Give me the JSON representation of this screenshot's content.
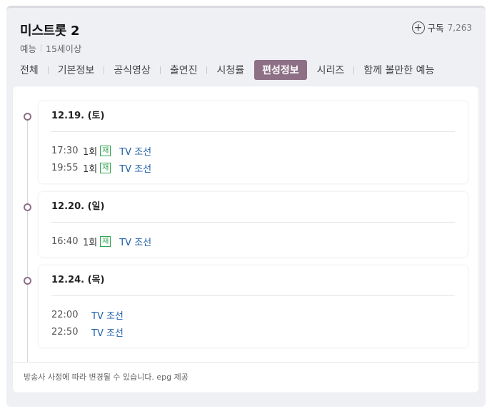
{
  "program": {
    "title": "미스트롯 2",
    "genre": "예능",
    "rating": "15세이상"
  },
  "subscribe": {
    "label": "구독",
    "count": "7,263"
  },
  "tabs": [
    {
      "label": "전체"
    },
    {
      "label": "기본정보"
    },
    {
      "label": "공식영상"
    },
    {
      "label": "출연진"
    },
    {
      "label": "시청률"
    },
    {
      "label": "편성정보",
      "active": true
    },
    {
      "label": "시리즈"
    },
    {
      "label": "함께 볼만한 예능"
    }
  ],
  "schedule": [
    {
      "date": "12.19. (토)",
      "slots": [
        {
          "time": "17:30",
          "episode": "1회",
          "badge": "재",
          "channel": "TV 조선"
        },
        {
          "time": "19:55",
          "episode": "1회",
          "badge": "재",
          "channel": "TV 조선"
        }
      ]
    },
    {
      "date": "12.20. (일)",
      "slots": [
        {
          "time": "16:40",
          "episode": "1회",
          "badge": "재",
          "channel": "TV 조선"
        }
      ]
    },
    {
      "date": "12.24. (목)",
      "slots": [
        {
          "time": "22:00",
          "channel": "TV 조선"
        },
        {
          "time": "22:50",
          "channel": "TV 조선"
        }
      ]
    }
  ],
  "notice": "방송사 사정에 따라 변경될 수 있습니다. epg 제공",
  "colors": {
    "accent": "#8d7086",
    "rerun_badge": "#2ea44f",
    "link": "#1d5ea8"
  }
}
